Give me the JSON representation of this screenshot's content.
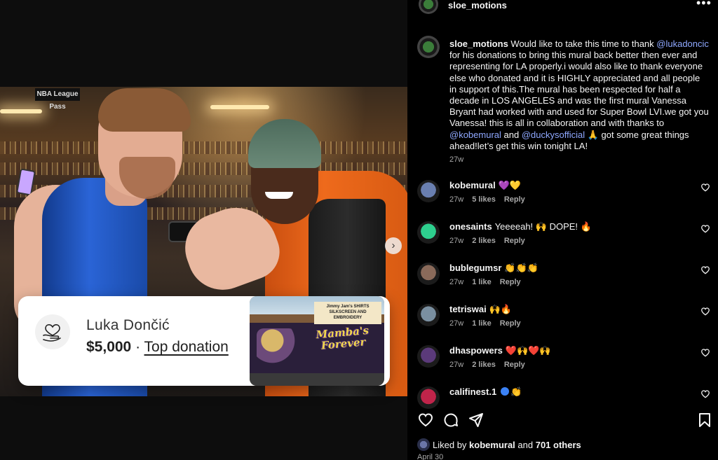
{
  "post": {
    "username": "sloe_motions",
    "caption_parts": [
      {
        "t": "user",
        "v": "sloe_motions"
      },
      {
        "t": "text",
        "v": " Would like to take this time to thank "
      },
      {
        "t": "mention",
        "v": "@lukadoncic"
      },
      {
        "t": "text",
        "v": " for his donations to bring this mural back better then ever and representing for LA properly.i would also like to thank everyone else who donated and it is HIGHLY appreciated and all people in support of this.The mural has been respected for half a decade in LOS ANGELES and was the first mural Vanessa Bryant had worked with and used for Super Bowl LVI.we got you Vanessa! this is all in collaboration and with thanks to "
      },
      {
        "t": "mention",
        "v": "@kobemural"
      },
      {
        "t": "text",
        "v": " and "
      },
      {
        "t": "mention",
        "v": "@duckysofficial"
      },
      {
        "t": "text",
        "v": " 🙏 got some great things ahead!let’s get this win tonight LA!"
      }
    ],
    "caption_time": "27w",
    "liked_by_prefix": "Liked by ",
    "liked_by_user": "kobemural",
    "liked_by_and": " and ",
    "liked_by_others": "701 others",
    "date": "April 30"
  },
  "image": {
    "banner_text": "NBA League Pass",
    "next_icon": "chevron-right-icon",
    "next_glyph": "›"
  },
  "donation_card": {
    "name": "Luka Dončić",
    "amount": "$5,000",
    "separator": " · ",
    "label": "Top donation",
    "thumb_sign": "Jimmy Jam's SHIRTS SILKSCREEN AND EMBROIDERY",
    "thumb_mural": "Mamba's Forever"
  },
  "comments": [
    {
      "user": "kobemural",
      "text": "💜💛",
      "time": "27w",
      "likes": "5 likes",
      "reply": "Reply",
      "verified": false,
      "avatar": "#6a7fb0"
    },
    {
      "user": "onesaints",
      "text": "Yeeeeah! 🙌 DOPE! 🔥",
      "time": "27w",
      "likes": "2 likes",
      "reply": "Reply",
      "verified": false,
      "avatar": "#2ecf8e"
    },
    {
      "user": "bublegumsr",
      "text": "👏👏👏",
      "time": "27w",
      "likes": "1 like",
      "reply": "Reply",
      "verified": false,
      "avatar": "#8a6a5a"
    },
    {
      "user": "tetriswai",
      "text": "🙌🔥",
      "time": "27w",
      "likes": "1 like",
      "reply": "Reply",
      "verified": false,
      "avatar": "#7a8fa0"
    },
    {
      "user": "dhaspowers",
      "text": "❤️🙌❤️🙌",
      "time": "27w",
      "likes": "2 likes",
      "reply": "Reply",
      "verified": false,
      "avatar": "#5b3a7a"
    },
    {
      "user": "califinest.1",
      "text": "👏",
      "time": "",
      "likes": "",
      "reply": "",
      "verified": true,
      "avatar": "#c0244a"
    }
  ],
  "icons": {
    "more": "more-icon",
    "more_glyph": "•••",
    "like": "heart-icon",
    "comment": "comment-icon",
    "share": "share-icon",
    "save": "bookmark-icon"
  }
}
